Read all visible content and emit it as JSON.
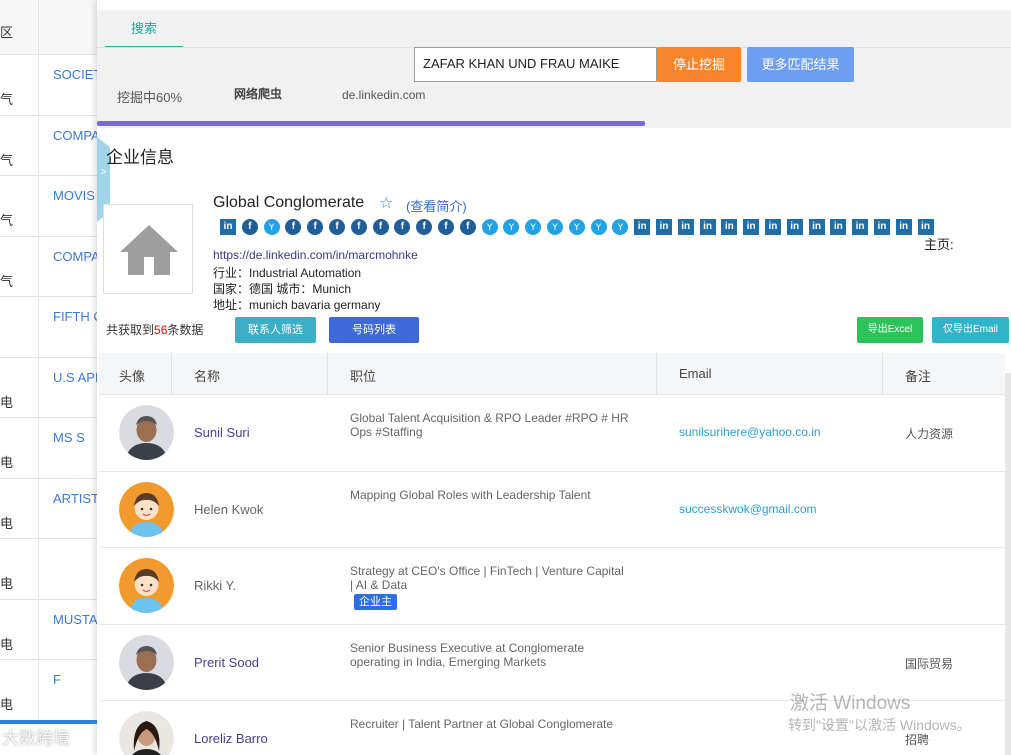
{
  "background_table": {
    "header_col1": "区",
    "rows": [
      {
        "col1": "气",
        "col2": "SOCIET"
      },
      {
        "col1": "气",
        "col2": "COMPA"
      },
      {
        "col1": "气",
        "col2": "MOVIS"
      },
      {
        "col1": "气",
        "col2": "COMPA"
      },
      {
        "col1": "",
        "col2": "FIFTH C"
      },
      {
        "col1": "电",
        "col2": "U.S API"
      },
      {
        "col1": "电",
        "col2": "MS S"
      },
      {
        "col1": "电",
        "col2": "ARTIST"
      },
      {
        "col1": "电",
        "col2": ""
      },
      {
        "col1": "电",
        "col2": "MUSTA"
      },
      {
        "col1": "电",
        "col2": "F"
      }
    ]
  },
  "top": {
    "tab_label": "搜索",
    "search_value": "ZAFAR KHAN UND FRAU MAIKE",
    "stop_button": "停止挖掘",
    "more_button": "更多匹配结果",
    "progress_text": "挖掘中60%",
    "progress_fraction": 0.6,
    "crawler_label": "网络爬虫",
    "domain": "de.linkedin.com",
    "handle_glyph": ">"
  },
  "company": {
    "section_title": "企业信息",
    "name": "Global Conglomerate",
    "star": "☆",
    "view_profile": "(查看简介)",
    "homepage_label": "主页:",
    "url": "https://de.linkedin.com/in/marcmohnke",
    "industry": "行业：Industrial Automation",
    "country_city": "国家：德国 城市：Munich",
    "address": "地址：munich bavaria germany",
    "social_icons": [
      "linkedin",
      "facebook",
      "twitter",
      "facebook",
      "facebook",
      "facebook",
      "facebook",
      "facebook",
      "facebook",
      "facebook",
      "facebook",
      "facebook",
      "twitter",
      "twitter",
      "twitter",
      "twitter",
      "twitter",
      "twitter",
      "twitter",
      "linkedin",
      "linkedin",
      "linkedin",
      "linkedin",
      "linkedin",
      "linkedin",
      "linkedin",
      "linkedin",
      "linkedin",
      "linkedin",
      "linkedin",
      "linkedin",
      "linkedin",
      "linkedin"
    ]
  },
  "actions": {
    "count_prefix": "共获取到",
    "count_value": "56",
    "count_suffix": "条数据",
    "filter_button": "联系人筛选",
    "phone_button": "号码列表",
    "export_excel": "导出Excel",
    "export_email": "仅导出Email"
  },
  "contacts_table": {
    "headers": {
      "avatar": "头像",
      "name": "名称",
      "title": "职位",
      "email": "Email",
      "note": "备注"
    },
    "rows": [
      {
        "name": "Sunil Suri",
        "title": "Global Talent Acquisition & RPO Leader #RPO # HR Ops #Staffing",
        "badge": "",
        "email": "sunilsurihere@yahoo.co.in",
        "note": "人力资源"
      },
      {
        "name": "Helen Kwok",
        "title": "Mapping Global Roles with Leadership Talent",
        "badge": "",
        "email": "successkwok@gmail.com",
        "note": ""
      },
      {
        "name": "Rikki Y.",
        "title": "Strategy at CEO's Office | FinTech | Venture Capital | AI & Data",
        "badge": "企业主",
        "email": "",
        "note": ""
      },
      {
        "name": "Prerit Sood",
        "title": "Senior Business Executive at Conglomerate operating in India, Emerging Markets",
        "badge": "",
        "email": "",
        "note": "国际贸易"
      },
      {
        "name": "Loreliz Barro",
        "title": "Recruiter | Talent Partner at Global Conglomerate",
        "badge": "",
        "email": "",
        "note": "招聘"
      }
    ]
  },
  "watermark": {
    "line1": "激活 Windows",
    "line2": "转到\"设置\"以激活 Windows。",
    "brand": "大数跨境"
  },
  "colors": {
    "accent_teal": "#26a69a",
    "stop_orange": "#f7852d",
    "more_blue": "#6d9ef0",
    "progress_purple": "#7b66e6",
    "email_blue": "#2a9fd6",
    "count_red": "#ee0000"
  }
}
